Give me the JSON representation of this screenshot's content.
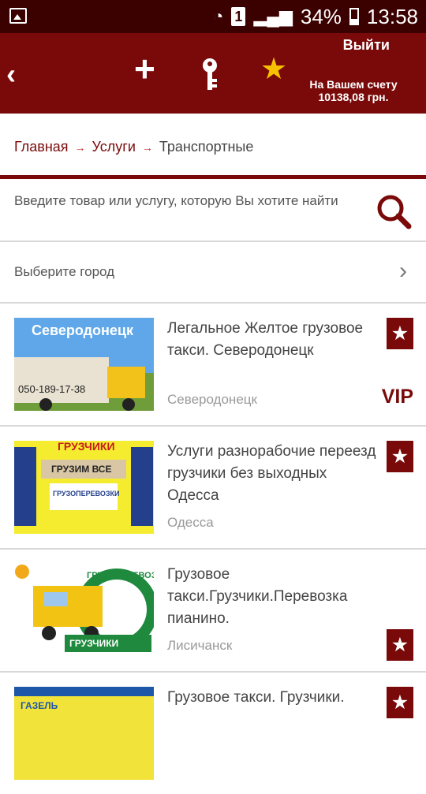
{
  "status": {
    "sim": "1",
    "battery": "34%",
    "time": "13:58"
  },
  "header": {
    "logout": "Выйти",
    "account_label": "На Вашем счету",
    "balance": "10138,08 грн."
  },
  "breadcrumb": {
    "home": "Главная",
    "services": "Услуги",
    "current": "Транспортные"
  },
  "search": {
    "placeholder": "Введите товар или услугу, которую Вы хотите найти"
  },
  "city": {
    "label": "Выберите город"
  },
  "listings": [
    {
      "title": "Легальное Желтое грузовое такси. Северодонецк",
      "city": "Северодонецк",
      "vip": "VIP",
      "image_text_top": "Северодонецк",
      "image_text_bottom": "050-189-17-38"
    },
    {
      "title": "Услуги разнорабочие переезд грузчики без выходных Одесса",
      "city": "Одесса",
      "image_text_top": "ГРУЗЧИКИ",
      "image_text_mid": "ГРУЗИМ ВСЕ",
      "image_text_bottom": "ГРУЗОПЕРЕВОЗКИ"
    },
    {
      "title": "Грузовое такси.Грузчики.Перевозка пианино.",
      "city": "Лисичанск",
      "image_text_top": "ГРУЗОПЕРЕВОЗКИ",
      "image_text_bottom": "ГРУЗЧИКИ"
    },
    {
      "title": "Грузовое такси. Грузчики.",
      "image_text_top": "ГАЗЕЛЬ"
    }
  ],
  "colors": {
    "brand": "#7a0a0a",
    "status_bg": "#3b0000",
    "accent_star": "#f6c200"
  }
}
